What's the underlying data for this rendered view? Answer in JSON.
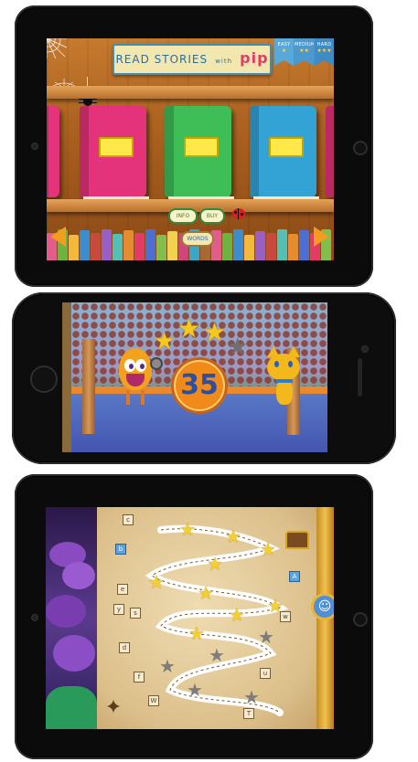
{
  "screen1": {
    "title_left": "READ STORIES",
    "title_with": "with",
    "title_brand": "pip",
    "difficulty": [
      {
        "label": "EASY",
        "stars": "★"
      },
      {
        "label": "MEDIUM",
        "stars": "★★"
      },
      {
        "label": "HARD",
        "stars": "★★★"
      }
    ],
    "buttons": {
      "info": "INFO",
      "buy": "BUY",
      "words": "WORDS"
    },
    "books": [
      {
        "color": "#e4337a"
      },
      {
        "color": "#3fbe58"
      },
      {
        "color": "#33a3d6"
      }
    ],
    "colors": {
      "arrow": "#f39c1f"
    }
  },
  "screen2": {
    "score": "35",
    "stars": {
      "gold": 3,
      "gray": 1
    }
  },
  "screen3": {
    "letters": [
      "c",
      "b",
      "A",
      "e",
      "y",
      "s",
      "d",
      "w",
      "f",
      "u",
      "W",
      "T"
    ]
  }
}
